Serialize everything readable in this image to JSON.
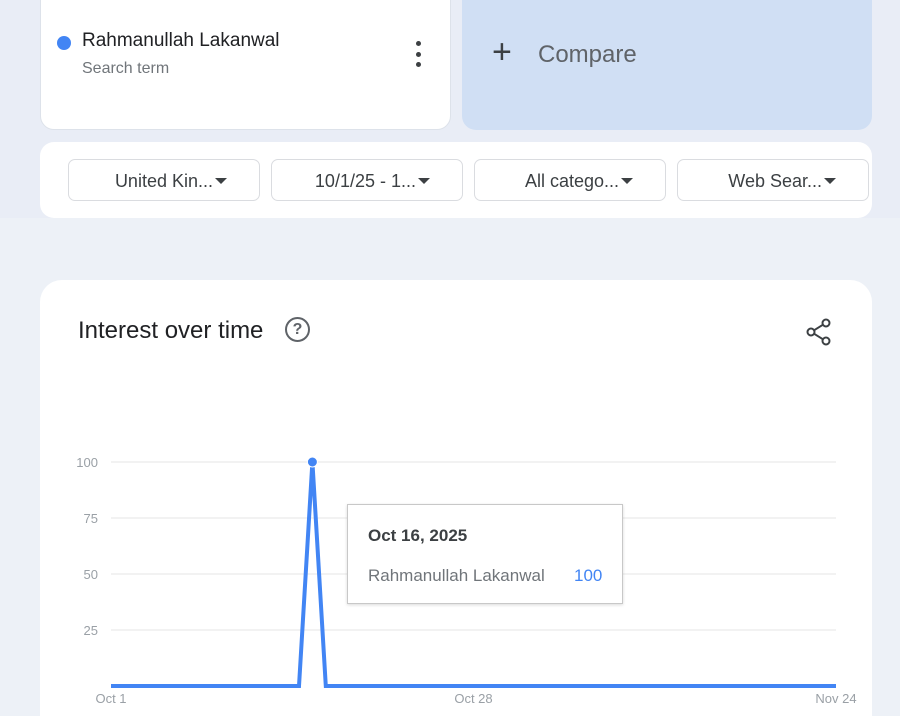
{
  "search_term": {
    "name": "Rahmanullah Lakanwal",
    "subtitle": "Search term",
    "color": "#4285f4"
  },
  "compare": {
    "label": "Compare"
  },
  "filters": [
    {
      "label": "United Kin..."
    },
    {
      "label": "10/1/25 - 1..."
    },
    {
      "label": "All catego..."
    },
    {
      "label": "Web Sear..."
    }
  ],
  "chart_section": {
    "title": "Interest over time"
  },
  "chart_data": {
    "type": "line",
    "title": "Interest over time",
    "series": [
      {
        "name": "Rahmanullah Lakanwal",
        "color": "#4285f4",
        "points": [
          {
            "date": "2025-10-01",
            "value": 0
          },
          {
            "date": "2025-10-15",
            "value": 0
          },
          {
            "date": "2025-10-16",
            "value": 100
          },
          {
            "date": "2025-10-17",
            "value": 0
          },
          {
            "date": "2025-11-24",
            "value": 0
          }
        ]
      }
    ],
    "x_ticks": [
      "Oct 1",
      "Oct 28",
      "Nov 24"
    ],
    "y_ticks": [
      25,
      50,
      75,
      100
    ],
    "ylim": [
      0,
      100
    ],
    "grid": true
  },
  "tooltip": {
    "date": "Oct 16, 2025",
    "term": "Rahmanullah Lakanwal",
    "value": "100"
  }
}
